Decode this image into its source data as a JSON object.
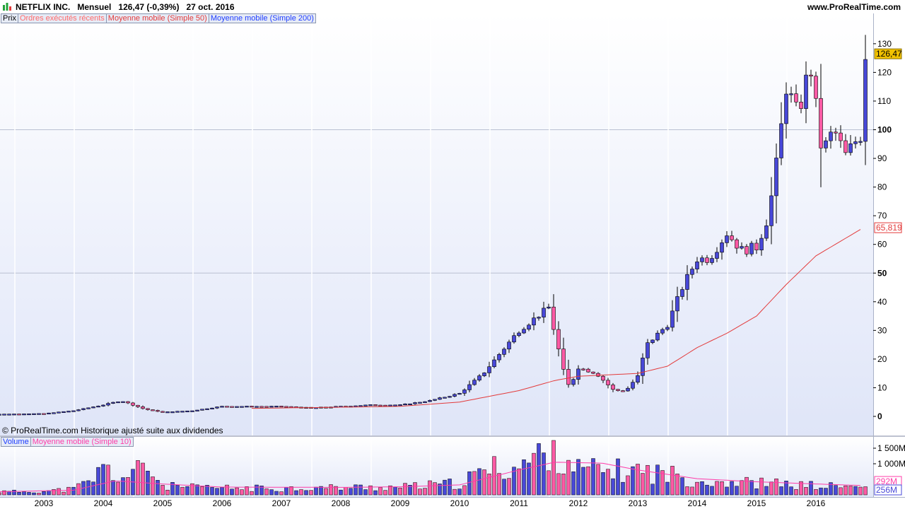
{
  "header": {
    "instrument": "NETFLIX INC.",
    "period": "Mensuel",
    "price": "126,47 (-0,39%)",
    "date": "27 oct. 2016",
    "site": "www.ProRealTime.com"
  },
  "price_legend": [
    {
      "label": "Prix",
      "color": "#000000"
    },
    {
      "label": "Ordres exécutés récents",
      "color": "#ff6a6a"
    },
    {
      "label": "Moyenne mobile (Simple 50)",
      "color": "#e33b3b"
    },
    {
      "label": "Moyenne mobile (Simple 200)",
      "color": "#1e3cff"
    }
  ],
  "volume_legend": [
    {
      "label": "Volume",
      "color": "#1e3cff"
    },
    {
      "label": "Moyenne mobile (Simple 10)",
      "color": "#ff3ca8"
    }
  ],
  "credit": "© ProRealTime.com  Historique ajusté suite aux dividendes",
  "colors": {
    "up": "#4848d8",
    "down": "#ff5aa5",
    "ma": "#e33b3b",
    "vol_ma": "#ff3ca8",
    "pane_bg": "#e6ebfa",
    "last_price_badge": "#f2c200"
  },
  "chart_data": [
    {
      "type": "candlestick",
      "title": "NETFLIX INC.",
      "interval": "monthly",
      "x_ticks": [
        "2003",
        "2004",
        "2005",
        "2006",
        "2007",
        "2008",
        "2009",
        "2010",
        "2011",
        "2012",
        "2013",
        "2014",
        "2015",
        "2016"
      ],
      "y_ticks": [
        0,
        10,
        20,
        30,
        40,
        50,
        60,
        70,
        80,
        90,
        100,
        110,
        120,
        130
      ],
      "y_ticks_bold": [
        0,
        50,
        100
      ],
      "ylim": [
        -3,
        133
      ],
      "last_price": "126,47",
      "ma_label": "65,819",
      "anchors": [
        {
          "year": 2002.0,
          "close": 0.7
        },
        {
          "year": 2003.0,
          "close": 1.0
        },
        {
          "year": 2003.5,
          "close": 2.0
        },
        {
          "year": 2004.0,
          "close": 4.0
        },
        {
          "year": 2004.3,
          "close": 5.5
        },
        {
          "year": 2004.7,
          "close": 2.5
        },
        {
          "year": 2005.0,
          "close": 1.5
        },
        {
          "year": 2005.5,
          "close": 2.0
        },
        {
          "year": 2006.0,
          "close": 3.5
        },
        {
          "year": 2006.5,
          "close": 3.5
        },
        {
          "year": 2007.0,
          "close": 3.5
        },
        {
          "year": 2007.5,
          "close": 3.0
        },
        {
          "year": 2008.0,
          "close": 3.5
        },
        {
          "year": 2008.5,
          "close": 4.0
        },
        {
          "year": 2009.0,
          "close": 4.0
        },
        {
          "year": 2009.5,
          "close": 5.5
        },
        {
          "year": 2010.0,
          "close": 8.0
        },
        {
          "year": 2010.4,
          "close": 15.0
        },
        {
          "year": 2010.8,
          "close": 25.0
        },
        {
          "year": 2011.0,
          "close": 30.0
        },
        {
          "year": 2011.5,
          "close": 38.0
        },
        {
          "year": 2011.75,
          "close": 16.0
        },
        {
          "year": 2011.85,
          "close": 10.0
        },
        {
          "year": 2012.0,
          "close": 17.0
        },
        {
          "year": 2012.3,
          "close": 15.0
        },
        {
          "year": 2012.6,
          "close": 9.0
        },
        {
          "year": 2012.8,
          "close": 9.0
        },
        {
          "year": 2013.0,
          "close": 14.0
        },
        {
          "year": 2013.15,
          "close": 25.0
        },
        {
          "year": 2013.5,
          "close": 32.0
        },
        {
          "year": 2013.75,
          "close": 45.0
        },
        {
          "year": 2014.0,
          "close": 55.0
        },
        {
          "year": 2014.2,
          "close": 55.0
        },
        {
          "year": 2014.5,
          "close": 64.0
        },
        {
          "year": 2014.75,
          "close": 58.0
        },
        {
          "year": 2015.0,
          "close": 59.0
        },
        {
          "year": 2015.2,
          "close": 70.0
        },
        {
          "year": 2015.35,
          "close": 90.0
        },
        {
          "year": 2015.5,
          "close": 115.0
        },
        {
          "year": 2015.7,
          "close": 105.0
        },
        {
          "year": 2015.9,
          "close": 123.0
        },
        {
          "year": 2016.0,
          "close": 108.0
        },
        {
          "year": 2016.1,
          "close": 92.0
        },
        {
          "year": 2016.3,
          "close": 100.0
        },
        {
          "year": 2016.5,
          "close": 91.0
        },
        {
          "year": 2016.7,
          "close": 97.0
        },
        {
          "year": 2016.75,
          "close": 98.0
        },
        {
          "year": 2016.8,
          "close": 126.47
        }
      ],
      "moving_average": {
        "name": "Moyenne mobile (Simple 50)",
        "anchors": [
          {
            "year": 2006.5,
            "value": 2.8
          },
          {
            "year": 2008.0,
            "value": 3.2
          },
          {
            "year": 2009.0,
            "value": 3.5
          },
          {
            "year": 2010.0,
            "value": 5.0
          },
          {
            "year": 2011.0,
            "value": 9.0
          },
          {
            "year": 2011.6,
            "value": 12.5
          },
          {
            "year": 2012.0,
            "value": 14.0
          },
          {
            "year": 2013.0,
            "value": 15.0
          },
          {
            "year": 2013.5,
            "value": 17.5
          },
          {
            "year": 2014.0,
            "value": 24.0
          },
          {
            "year": 2014.5,
            "value": 29.0
          },
          {
            "year": 2015.0,
            "value": 35.0
          },
          {
            "year": 2015.5,
            "value": 46.0
          },
          {
            "year": 2016.0,
            "value": 56.0
          },
          {
            "year": 2016.8,
            "value": 65.819
          }
        ]
      }
    },
    {
      "type": "bar",
      "title": "Volume",
      "y_ticks": [
        "1 500M",
        "1 000M"
      ],
      "y_tick_values": [
        1500,
        1000
      ],
      "ylim": [
        0,
        1700
      ],
      "unit": "M",
      "last_volume_labels": [
        "292M",
        "256M"
      ],
      "volume_anchors": [
        {
          "year": 2002.0,
          "value": 100
        },
        {
          "year": 2003.0,
          "value": 120
        },
        {
          "year": 2003.5,
          "value": 200
        },
        {
          "year": 2003.8,
          "value": 480
        },
        {
          "year": 2004.0,
          "value": 900
        },
        {
          "year": 2004.3,
          "value": 550
        },
        {
          "year": 2004.75,
          "value": 950
        },
        {
          "year": 2005.0,
          "value": 300
        },
        {
          "year": 2005.5,
          "value": 250
        },
        {
          "year": 2006.0,
          "value": 230
        },
        {
          "year": 2007.0,
          "value": 220
        },
        {
          "year": 2008.0,
          "value": 250
        },
        {
          "year": 2009.0,
          "value": 260
        },
        {
          "year": 2010.0,
          "value": 380
        },
        {
          "year": 2010.5,
          "value": 880
        },
        {
          "year": 2011.0,
          "value": 950
        },
        {
          "year": 2011.6,
          "value": 1600
        },
        {
          "year": 2011.8,
          "value": 1300
        },
        {
          "year": 2012.0,
          "value": 850
        },
        {
          "year": 2012.7,
          "value": 800
        },
        {
          "year": 2013.0,
          "value": 820
        },
        {
          "year": 2013.5,
          "value": 700
        },
        {
          "year": 2014.0,
          "value": 500
        },
        {
          "year": 2015.0,
          "value": 400
        },
        {
          "year": 2016.0,
          "value": 300
        },
        {
          "year": 2016.8,
          "value": 256
        }
      ],
      "volume_ma_anchors": [
        {
          "year": 2002.0,
          "value": 90
        },
        {
          "year": 2003.5,
          "value": 150
        },
        {
          "year": 2004.2,
          "value": 450
        },
        {
          "year": 2005.0,
          "value": 350
        },
        {
          "year": 2006.0,
          "value": 250
        },
        {
          "year": 2008.0,
          "value": 240
        },
        {
          "year": 2009.0,
          "value": 260
        },
        {
          "year": 2010.0,
          "value": 320
        },
        {
          "year": 2011.0,
          "value": 800
        },
        {
          "year": 2011.6,
          "value": 1050
        },
        {
          "year": 2012.4,
          "value": 1020
        },
        {
          "year": 2013.0,
          "value": 800
        },
        {
          "year": 2014.0,
          "value": 520
        },
        {
          "year": 2015.0,
          "value": 420
        },
        {
          "year": 2016.0,
          "value": 350
        },
        {
          "year": 2016.8,
          "value": 300
        }
      ]
    }
  ]
}
